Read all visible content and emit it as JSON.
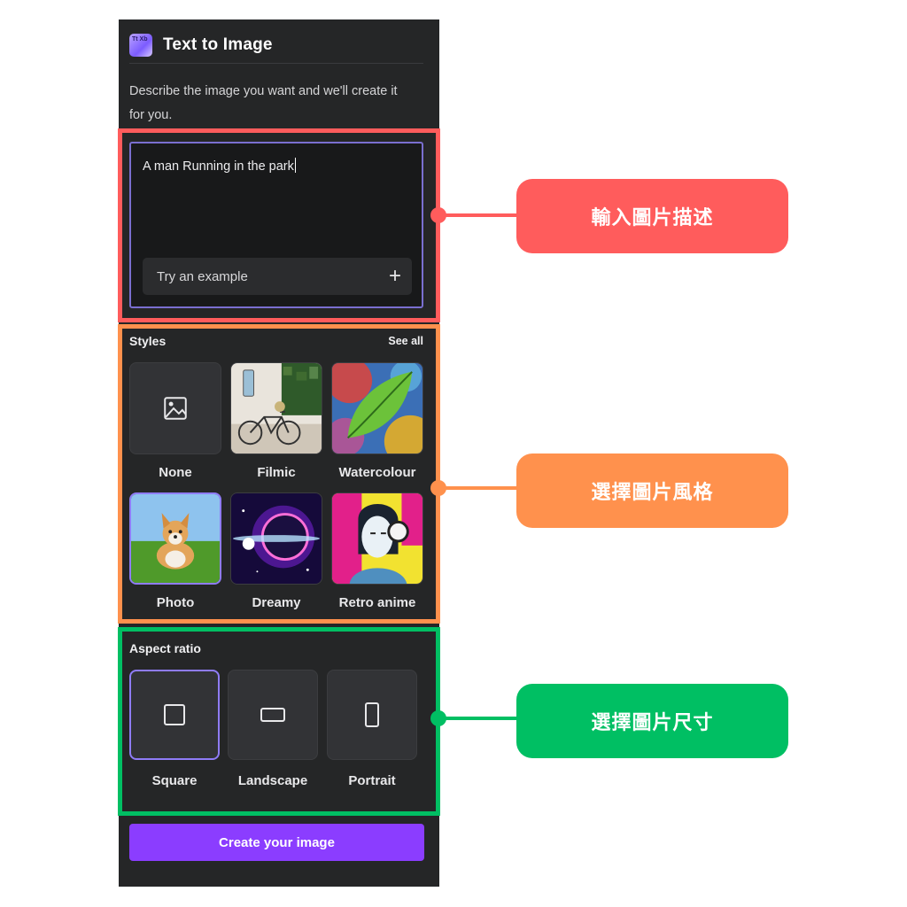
{
  "panel": {
    "title": "Text to Image",
    "logo_text": "Tt Xb",
    "description": "Describe the image you want and we'll create it for you.",
    "prompt": {
      "value": "A man Running in the park"
    },
    "try_example": {
      "label": "Try an example",
      "icon": "plus-icon",
      "symbol": "+"
    },
    "styles": {
      "title": "Styles",
      "see_all": "See all",
      "items": [
        {
          "label": "None",
          "icon": "image-icon",
          "selected": false
        },
        {
          "label": "Filmic",
          "icon": "bicycle-wall-thumbnail",
          "selected": false
        },
        {
          "label": "Watercolour",
          "icon": "leaf-watercolor-thumbnail",
          "selected": false
        },
        {
          "label": "Photo",
          "icon": "corgi-photo-thumbnail",
          "selected": true
        },
        {
          "label": "Dreamy",
          "icon": "planet-thumbnail",
          "selected": false
        },
        {
          "label": "Retro anime",
          "icon": "headphones-girl-thumbnail",
          "selected": false
        }
      ]
    },
    "aspect_ratio": {
      "title": "Aspect ratio",
      "items": [
        {
          "label": "Square",
          "icon": "square-icon",
          "selected": true
        },
        {
          "label": "Landscape",
          "icon": "landscape-rect-icon",
          "selected": false
        },
        {
          "label": "Portrait",
          "icon": "portrait-rect-icon",
          "selected": false
        }
      ]
    },
    "create_button": "Create your image"
  },
  "annotations": [
    {
      "label": "輸入圖片描述",
      "color": "#ff5c5c"
    },
    {
      "label": "選擇圖片風格",
      "color": "#ff914d"
    },
    {
      "label": "選擇圖片尺寸",
      "color": "#00bf63"
    }
  ],
  "colors": {
    "panel_bg": "#252627",
    "accent_purple": "#8b3dff",
    "selection_border": "#8f7cf7"
  }
}
